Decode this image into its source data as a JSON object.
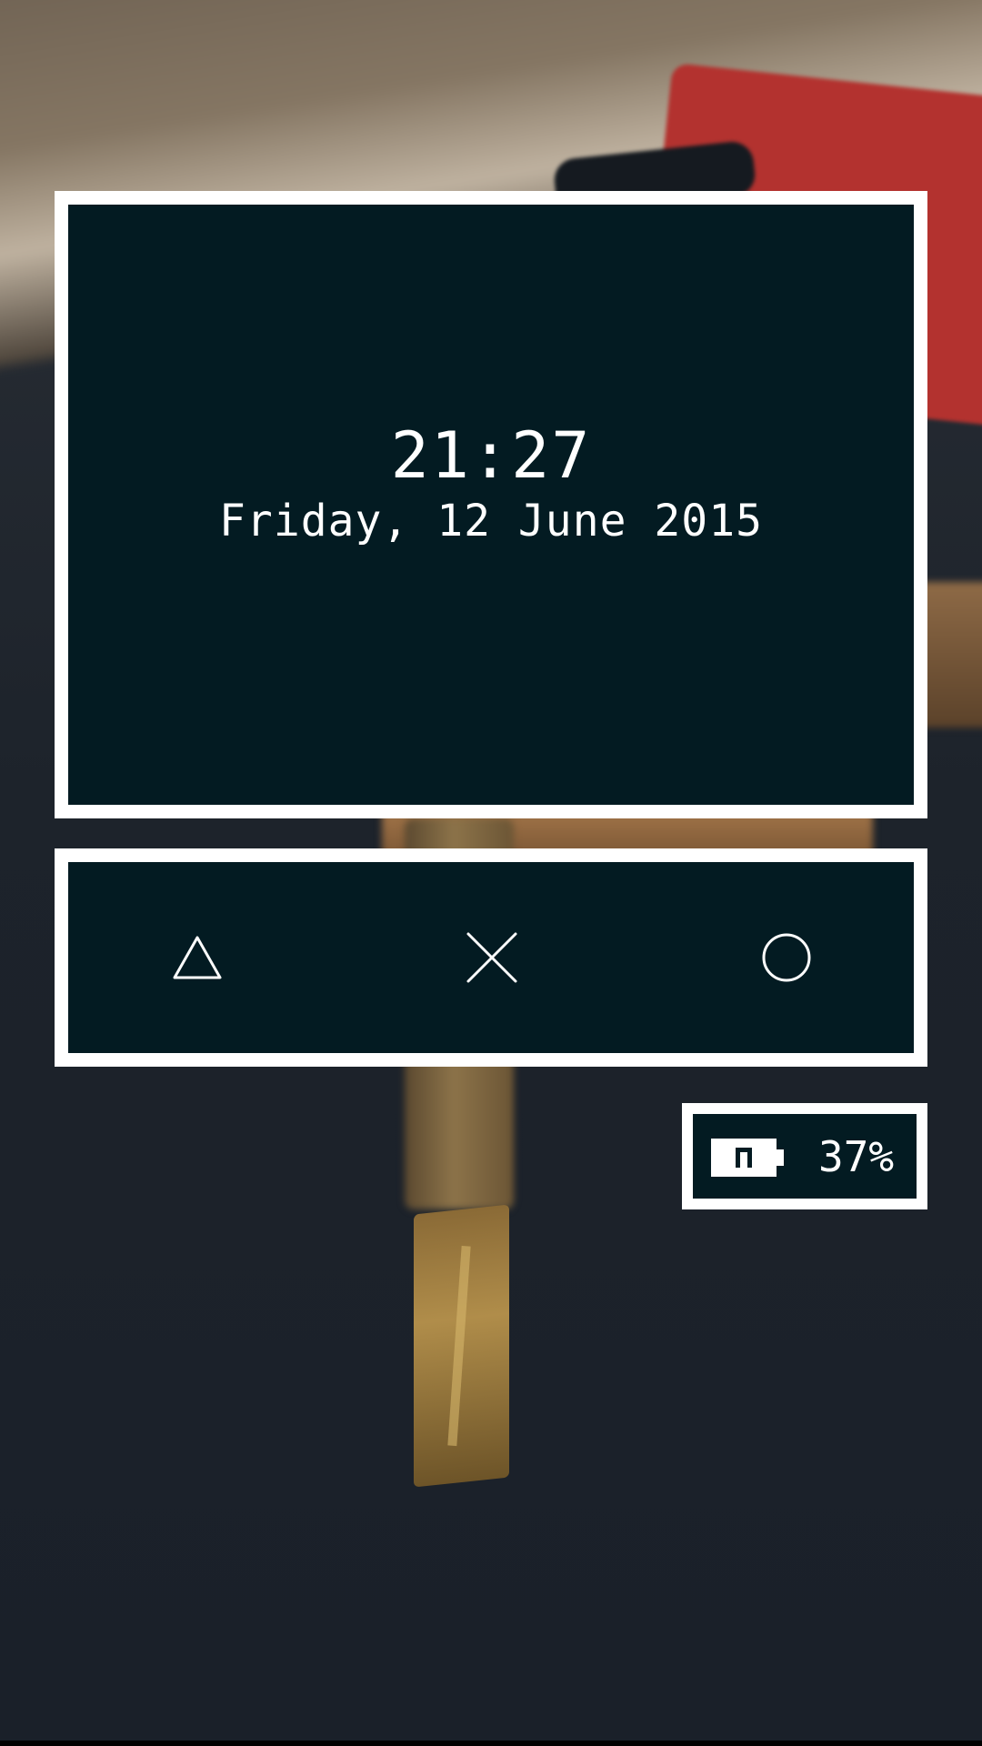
{
  "lockscreen": {
    "time": "21:27",
    "date": "Friday, 12 June 2015"
  },
  "navigation": {
    "back_icon": "triangle-icon",
    "home_icon": "cross-icon",
    "recent_icon": "circle-icon"
  },
  "battery": {
    "icon": "battery-icon",
    "level_text": "37%",
    "level_fraction": 0.37
  },
  "colors": {
    "panel_background": "#031b22",
    "panel_border": "#ffffff",
    "text": "#ffffff"
  }
}
